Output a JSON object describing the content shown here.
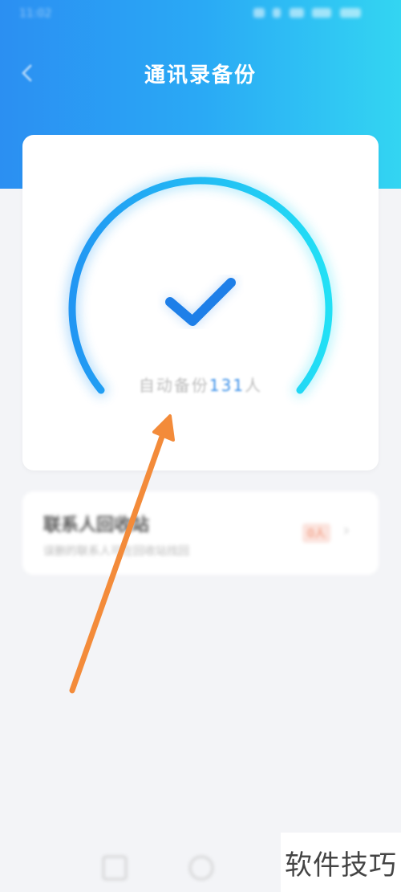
{
  "status_bar": {
    "time": "11:02"
  },
  "header": {
    "title": "通讯录备份"
  },
  "backup_card": {
    "count_prefix": "自动备份",
    "count_number": "131",
    "count_unit": "人"
  },
  "recycle_card": {
    "title": "联系人回收站",
    "subtitle": "误删的联系人可在回收站找回",
    "badge": "0人"
  },
  "watermark": {
    "text": "软件技巧"
  },
  "colors": {
    "header_start": "#2b8ff2",
    "header_end": "#33d5f2",
    "gauge_start": "#2196f3",
    "gauge_end": "#22e0f5",
    "check": "#1e7fe8",
    "arrow": "#f38b3a"
  },
  "icons": {
    "back": "chevron-left-icon",
    "check": "checkmark-icon",
    "forward": "chevron-right-icon",
    "annotation": "orange-arrow-annotation"
  }
}
